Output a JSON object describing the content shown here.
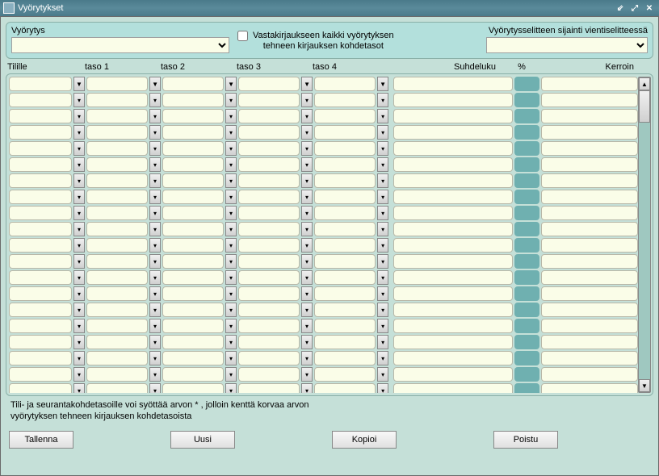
{
  "window": {
    "title": "Vyörytykset"
  },
  "top": {
    "vyorytys_label": "Vyörytys",
    "vyorytys_value": "",
    "checkbox_label_line1": "Vastakirjaukseen kaikki vyörytyksen",
    "checkbox_label_line2": "tehneen kirjauksen kohdetasot",
    "checkbox_checked": false,
    "selite_label": "Vyörytysselitteen sijainti vientiselitteessä",
    "selite_value": ""
  },
  "headers": {
    "tilille": "Tilille",
    "taso1": "taso 1",
    "taso2": "taso 2",
    "taso3": "taso 3",
    "taso4": "taso 4",
    "suhdeluku": "Suhdeluku",
    "pct": "%",
    "kerroin": "Kerroin"
  },
  "rows": [
    {
      "tilille": "",
      "t1": "",
      "t2": "",
      "t3": "",
      "t4": "",
      "suhdeluku": "",
      "pct": "",
      "kerroin": ""
    },
    {
      "tilille": "",
      "t1": "",
      "t2": "",
      "t3": "",
      "t4": "",
      "suhdeluku": "",
      "pct": "",
      "kerroin": ""
    },
    {
      "tilille": "",
      "t1": "",
      "t2": "",
      "t3": "",
      "t4": "",
      "suhdeluku": "",
      "pct": "",
      "kerroin": ""
    },
    {
      "tilille": "",
      "t1": "",
      "t2": "",
      "t3": "",
      "t4": "",
      "suhdeluku": "",
      "pct": "",
      "kerroin": ""
    },
    {
      "tilille": "",
      "t1": "",
      "t2": "",
      "t3": "",
      "t4": "",
      "suhdeluku": "",
      "pct": "",
      "kerroin": ""
    },
    {
      "tilille": "",
      "t1": "",
      "t2": "",
      "t3": "",
      "t4": "",
      "suhdeluku": "",
      "pct": "",
      "kerroin": ""
    },
    {
      "tilille": "",
      "t1": "",
      "t2": "",
      "t3": "",
      "t4": "",
      "suhdeluku": "",
      "pct": "",
      "kerroin": ""
    },
    {
      "tilille": "",
      "t1": "",
      "t2": "",
      "t3": "",
      "t4": "",
      "suhdeluku": "",
      "pct": "",
      "kerroin": ""
    },
    {
      "tilille": "",
      "t1": "",
      "t2": "",
      "t3": "",
      "t4": "",
      "suhdeluku": "",
      "pct": "",
      "kerroin": ""
    },
    {
      "tilille": "",
      "t1": "",
      "t2": "",
      "t3": "",
      "t4": "",
      "suhdeluku": "",
      "pct": "",
      "kerroin": ""
    },
    {
      "tilille": "",
      "t1": "",
      "t2": "",
      "t3": "",
      "t4": "",
      "suhdeluku": "",
      "pct": "",
      "kerroin": ""
    },
    {
      "tilille": "",
      "t1": "",
      "t2": "",
      "t3": "",
      "t4": "",
      "suhdeluku": "",
      "pct": "",
      "kerroin": ""
    },
    {
      "tilille": "",
      "t1": "",
      "t2": "",
      "t3": "",
      "t4": "",
      "suhdeluku": "",
      "pct": "",
      "kerroin": ""
    },
    {
      "tilille": "",
      "t1": "",
      "t2": "",
      "t3": "",
      "t4": "",
      "suhdeluku": "",
      "pct": "",
      "kerroin": ""
    },
    {
      "tilille": "",
      "t1": "",
      "t2": "",
      "t3": "",
      "t4": "",
      "suhdeluku": "",
      "pct": "",
      "kerroin": ""
    },
    {
      "tilille": "",
      "t1": "",
      "t2": "",
      "t3": "",
      "t4": "",
      "suhdeluku": "",
      "pct": "",
      "kerroin": ""
    },
    {
      "tilille": "",
      "t1": "",
      "t2": "",
      "t3": "",
      "t4": "",
      "suhdeluku": "",
      "pct": "",
      "kerroin": ""
    },
    {
      "tilille": "",
      "t1": "",
      "t2": "",
      "t3": "",
      "t4": "",
      "suhdeluku": "",
      "pct": "",
      "kerroin": ""
    },
    {
      "tilille": "",
      "t1": "",
      "t2": "",
      "t3": "",
      "t4": "",
      "suhdeluku": "",
      "pct": "",
      "kerroin": ""
    },
    {
      "tilille": "",
      "t1": "",
      "t2": "",
      "t3": "",
      "t4": "",
      "suhdeluku": "",
      "pct": "",
      "kerroin": ""
    }
  ],
  "footer": {
    "line1": "Tili- ja seurantakohdetasoille voi syöttää arvon * , jolloin kenttä korvaa arvon",
    "line2": "vyörytyksen tehneen kirjauksen kohdetasoista"
  },
  "buttons": {
    "tallenna": "Tallenna",
    "uusi": "Uusi",
    "kopioi": "Kopioi",
    "poistu": "Poistu"
  },
  "icons": {
    "dropdown": "▼",
    "dropdown_disabled": "▾",
    "scroll_up": "▲",
    "scroll_down": "▼"
  }
}
